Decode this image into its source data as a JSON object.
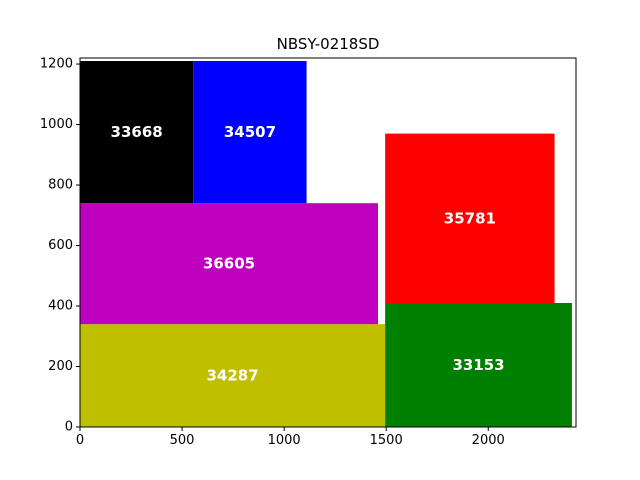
{
  "chart_data": {
    "type": "packing",
    "title": "NBSY-0218SD",
    "xlim": [
      0,
      2430
    ],
    "ylim": [
      0,
      1220
    ],
    "x_ticks": [
      0,
      500,
      1000,
      1500,
      2000
    ],
    "y_ticks": [
      0,
      200,
      400,
      600,
      800,
      1000,
      1200
    ],
    "grid": false,
    "rectangles": [
      {
        "label": "34287",
        "x": 0,
        "y": 0,
        "width": 1495,
        "height": 340,
        "color": "#bfbf00"
      },
      {
        "label": "33153",
        "x": 1495,
        "y": 0,
        "width": 915,
        "height": 410,
        "color": "#008000"
      },
      {
        "label": "36605",
        "x": 0,
        "y": 340,
        "width": 1460,
        "height": 400,
        "color": "#bf00bf"
      },
      {
        "label": "35781",
        "x": 1495,
        "y": 410,
        "width": 830,
        "height": 560,
        "color": "#ff0000"
      },
      {
        "label": "33668",
        "x": 0,
        "y": 740,
        "width": 555,
        "height": 470,
        "color": "#000000"
      },
      {
        "label": "34507",
        "x": 555,
        "y": 740,
        "width": 555,
        "height": 470,
        "color": "#0000ff"
      }
    ]
  }
}
